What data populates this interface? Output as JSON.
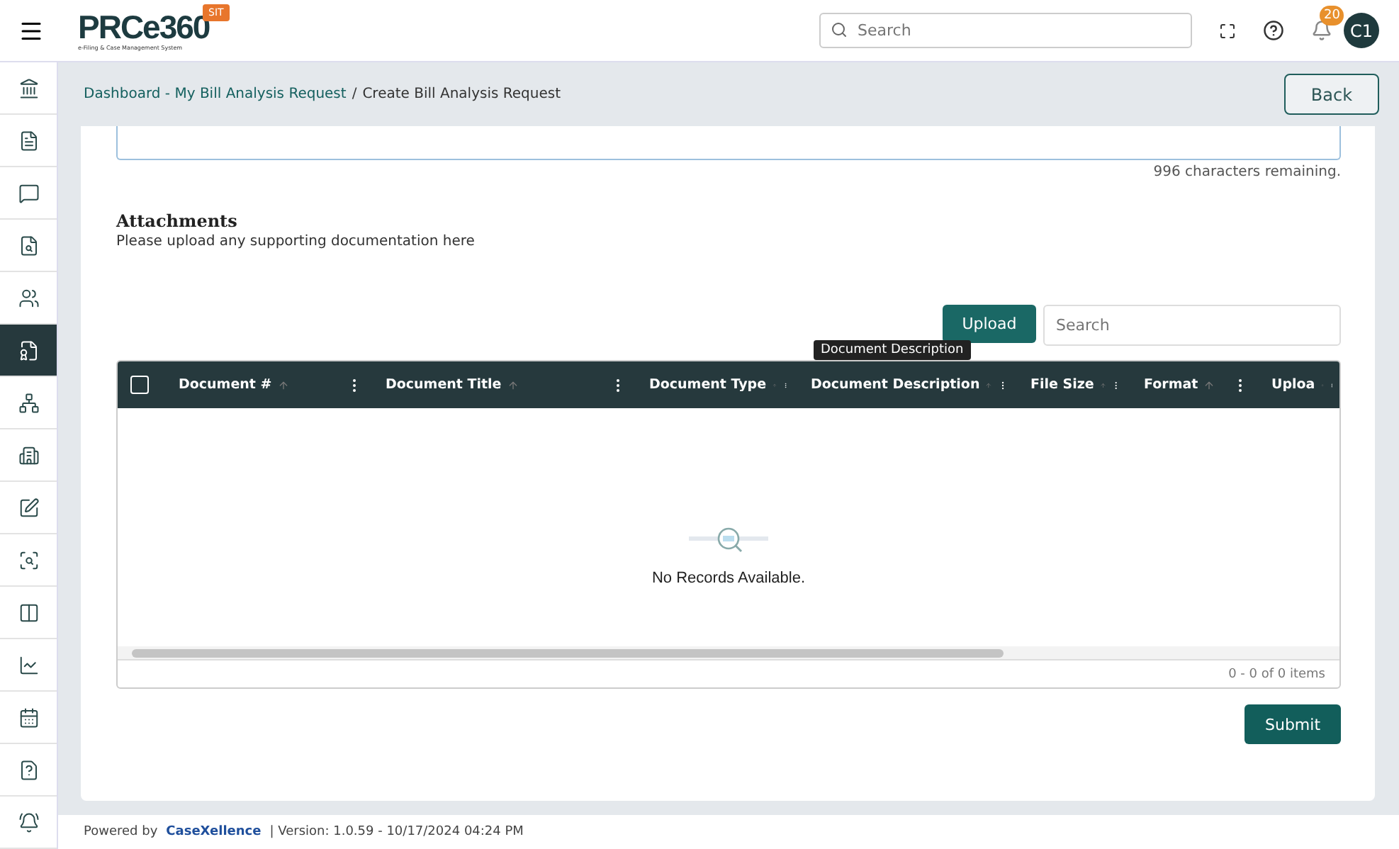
{
  "header": {
    "logo_text": "PRCe360",
    "logo_subtitle": "e-Filing & Case Management System",
    "env_badge": "SIT",
    "search": {
      "placeholder": "Search"
    },
    "notification_count": "20",
    "avatar": "C1"
  },
  "sidebar": {
    "items": [
      {
        "selected": false
      },
      {
        "selected": false
      },
      {
        "selected": false
      },
      {
        "selected": false
      },
      {
        "selected": false
      },
      {
        "selected": true
      },
      {
        "selected": false
      },
      {
        "selected": false
      },
      {
        "selected": false
      },
      {
        "selected": false
      },
      {
        "selected": false
      },
      {
        "selected": false
      },
      {
        "selected": false
      },
      {
        "selected": false
      },
      {
        "selected": false
      }
    ]
  },
  "breadcrumb": {
    "link": "Dashboard - My Bill Analysis Request",
    "separator": "/",
    "current": "Create Bill Analysis Request"
  },
  "back_button": "Back",
  "description": {
    "remaining": "996 characters remaining."
  },
  "attachments": {
    "title": "Attachments",
    "subtitle": "Please upload any supporting documentation here",
    "upload_button": "Upload",
    "search": {
      "placeholder": "Search"
    },
    "tooltip": "Document Description",
    "select_all": {
      "checked": false
    },
    "columns": [
      {
        "label": "Document #"
      },
      {
        "label": "Document Title"
      },
      {
        "label": "Document Type"
      },
      {
        "label": "Document Description"
      },
      {
        "label": "File Size"
      },
      {
        "label": "Format"
      },
      {
        "label": "Uploa"
      }
    ],
    "empty_message": "No Records Available.",
    "pager": "0 - 0 of 0 items"
  },
  "submit_button": "Submit",
  "footer": {
    "powered_by": "Powered by",
    "brand": "CaseXellence",
    "version": "|  Version: 1.0.59 - 10/17/2024 04:24 PM"
  }
}
